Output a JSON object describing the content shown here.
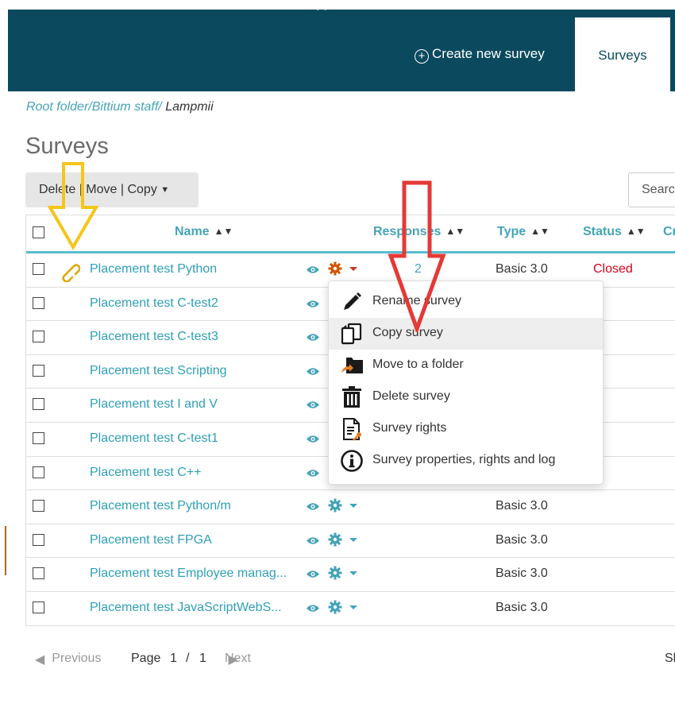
{
  "header": {
    "create_label": "Create new survey",
    "tab_surveys": "Surveys"
  },
  "breadcrumb": {
    "root": "Root folder/",
    "staff": "Bittium staff/",
    "current": "Lampmii"
  },
  "page_title": "Surveys",
  "bulk_actions": {
    "delete": "Delete",
    "move": "Move",
    "copy": "Copy",
    "label": "Delete | Move | Copy"
  },
  "search": {
    "placeholder": "Searc"
  },
  "table": {
    "columns": {
      "name": "Name",
      "responses": "Responses",
      "type": "Type",
      "status": "Status",
      "created": "Cr"
    },
    "rows": [
      {
        "name": "Placement test Python",
        "responses": "2",
        "type": "Basic 3.0",
        "status": "Closed",
        "linked": true
      },
      {
        "name": "Placement test C-test2",
        "responses": "",
        "type": "",
        "status": ""
      },
      {
        "name": "Placement test C-test3",
        "responses": "",
        "type": "",
        "status": ""
      },
      {
        "name": "Placement test Scripting",
        "responses": "",
        "type": "",
        "status": ""
      },
      {
        "name": "Placement test I and V",
        "responses": "",
        "type": "",
        "status": ""
      },
      {
        "name": "Placement test C-test1",
        "responses": "",
        "type": "",
        "status": ""
      },
      {
        "name": "Placement test C++",
        "responses": "",
        "type": "",
        "status": ""
      },
      {
        "name": "Placement test Python/m",
        "responses": "",
        "type": "Basic 3.0",
        "status": ""
      },
      {
        "name": "Placement test FPGA",
        "responses": "",
        "type": "Basic 3.0",
        "status": ""
      },
      {
        "name": "Placement test Employee manag...",
        "responses": "",
        "type": "Basic 3.0",
        "status": ""
      },
      {
        "name": "Placement test JavaScriptWebS...",
        "responses": "",
        "type": "Basic 3.0",
        "status": ""
      }
    ]
  },
  "dropdown": {
    "items": [
      {
        "label": "Rename survey",
        "icon": "pencil-icon"
      },
      {
        "label": "Copy survey",
        "icon": "copy-icon",
        "highlighted": true
      },
      {
        "label": "Move to a folder",
        "icon": "folder-move-icon"
      },
      {
        "label": "Delete survey",
        "icon": "trash-icon"
      },
      {
        "label": "Survey rights",
        "icon": "document-key-icon"
      },
      {
        "label": "Survey properties, rights and log",
        "icon": "info-icon"
      }
    ]
  },
  "pager": {
    "previous": "Previous",
    "page_label": "Page",
    "current": "1",
    "sep": "/",
    "total": "1",
    "next": "Next",
    "trailing": "Sl"
  },
  "colors": {
    "header_bg": "#0b4a5e",
    "link": "#46a3b8",
    "status_closed": "#d0021b",
    "gear_active": "#d35400",
    "annotation_yellow": "#f5c518",
    "annotation_red": "#e53935"
  }
}
